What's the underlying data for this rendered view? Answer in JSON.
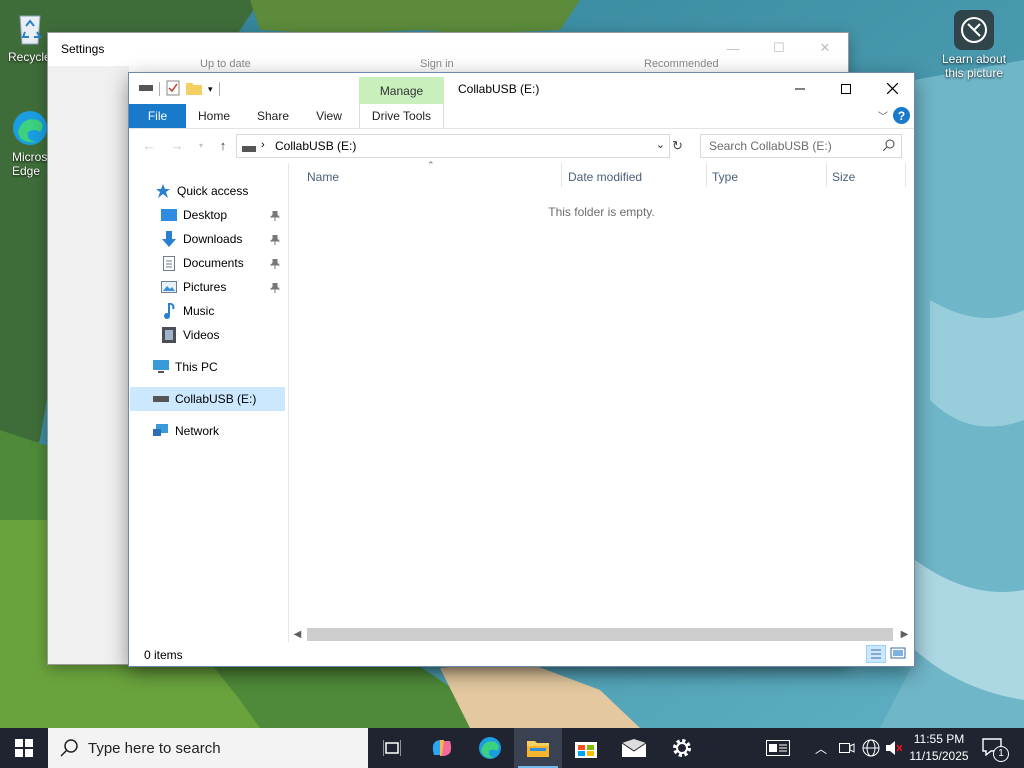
{
  "desktop": {
    "icons": {
      "recycle_bin": "Recycle Bin",
      "edge": "Microsoft Edge",
      "learn_about": "Learn about this picture"
    }
  },
  "settings_window": {
    "title": "Settings",
    "peek_left": "Up to date",
    "peek_mid": "Sign in",
    "peek_right": "Recommended"
  },
  "explorer": {
    "title": "CollabUSB (E:)",
    "contextual_tab": "Manage",
    "ribbon_tabs": [
      "File",
      "Home",
      "Share",
      "View",
      "Drive Tools"
    ],
    "address": "CollabUSB (E:)",
    "search_placeholder": "Search CollabUSB (E:)",
    "columns": [
      "Name",
      "Date modified",
      "Type",
      "Size"
    ],
    "empty_message": "This folder is empty.",
    "status": "0 items",
    "nav": {
      "quick_access": "Quick access",
      "desktop": "Desktop",
      "downloads": "Downloads",
      "documents": "Documents",
      "pictures": "Pictures",
      "music": "Music",
      "videos": "Videos",
      "this_pc": "This PC",
      "drive": "CollabUSB (E:)",
      "network": "Network"
    }
  },
  "taskbar": {
    "search_placeholder": "Type here to search",
    "time": "11:55 PM",
    "date": "11/15/2025",
    "notification_count": "1"
  },
  "colors": {
    "accent": "#1979ca",
    "manage_tab": "#c9efbd",
    "selected_nav": "#cce8ff",
    "taskbar": "#1f2430"
  }
}
